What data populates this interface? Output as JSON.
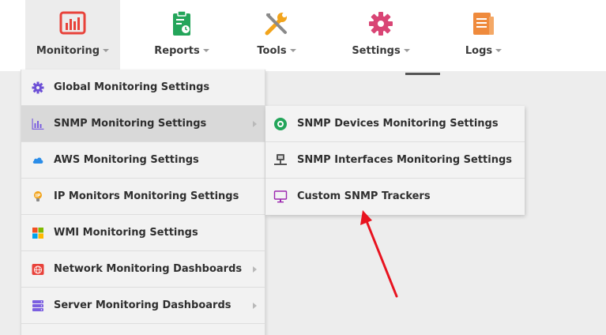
{
  "nav": {
    "items": [
      {
        "label": "Monitoring",
        "icon": "bar-chart-icon",
        "color": "#e8423a",
        "active": true
      },
      {
        "label": "Reports",
        "icon": "clipboard-icon",
        "color": "#23a55a",
        "active": false
      },
      {
        "label": "Tools",
        "icon": "tools-icon",
        "color": "#f2a41c",
        "active": false
      },
      {
        "label": "Settings",
        "icon": "gear-icon",
        "color": "#d94575",
        "active": false
      },
      {
        "label": "Logs",
        "icon": "document-icon",
        "color": "#ef8a3c",
        "active": false
      }
    ]
  },
  "menu": {
    "items": [
      {
        "label": "Global Monitoring Settings",
        "icon": "gear-icon",
        "color": "#6c4fd6",
        "submenu": false
      },
      {
        "label": "SNMP Monitoring Settings",
        "icon": "bar-chart-icon",
        "color": "#7b5fe0",
        "submenu": true,
        "highlighted": true
      },
      {
        "label": "AWS Monitoring Settings",
        "icon": "cloud-icon",
        "color": "#2b8de8",
        "submenu": false
      },
      {
        "label": "IP Monitors Monitoring Settings",
        "icon": "lightbulb-icon",
        "color": "#f2a41c",
        "submenu": false
      },
      {
        "label": "WMI Monitoring Settings",
        "icon": "windows-icon",
        "color": "#f25022",
        "submenu": false
      },
      {
        "label": "Network Monitoring Dashboards",
        "icon": "globe-icon",
        "color": "#e8423a",
        "submenu": true
      },
      {
        "label": "Server Monitoring Dashboards",
        "icon": "server-icon",
        "color": "#7b5fe0",
        "submenu": true
      }
    ]
  },
  "submenu": {
    "items": [
      {
        "label": "SNMP Devices Monitoring Settings",
        "icon": "device-icon",
        "color": "#23a55a"
      },
      {
        "label": "SNMP Interfaces Monitoring Settings",
        "icon": "network-interface-icon",
        "color": "#555555"
      },
      {
        "label": "Custom SNMP Trackers",
        "icon": "monitor-icon",
        "color": "#9c27b0"
      }
    ]
  },
  "annotation": {
    "arrow_color": "#e8131f"
  }
}
